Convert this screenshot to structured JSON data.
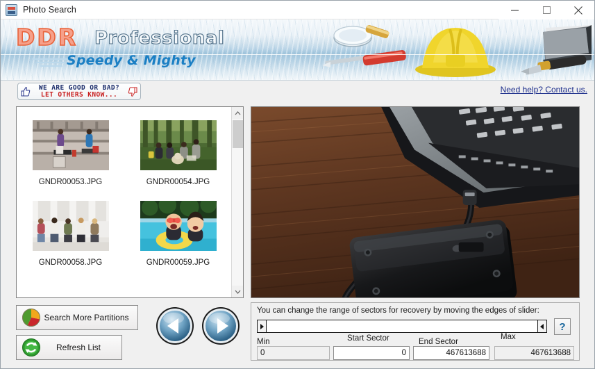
{
  "window": {
    "title": "Photo Search",
    "icon": "app-icon",
    "controls": {
      "minimize": "minimize-icon",
      "maximize": "maximize-icon",
      "close": "close-icon"
    }
  },
  "banner": {
    "brand_primary": "DDR",
    "brand_secondary": "Professional",
    "tagline": "Speedy & Mighty",
    "artwork": [
      "magnifier-icon",
      "screwdriver-icon",
      "hardhat-icon",
      "book-icon",
      "pen-icon"
    ],
    "colors": {
      "brand_orange": "#e8633b",
      "tagline_blue": "#1b7fc4",
      "water_blue": "#9fc4dc"
    }
  },
  "linkrow": {
    "rate_badge_line1": "WE ARE GOOD OR BAD?",
    "rate_badge_line2": "LET OTHERS KNOW...",
    "contact_link": "Need help? Contact us."
  },
  "filelist": {
    "files": [
      {
        "name": "GNDR00053.JPG",
        "scene": "two-women-on-steps"
      },
      {
        "name": "GNDR00054.JPG",
        "scene": "group-picnic-forest"
      },
      {
        "name": "GNDR00058.JPG",
        "scene": "group-of-friends-sitting"
      },
      {
        "name": "GNDR00059.JPG",
        "scene": "kids-in-swimming-pool"
      }
    ],
    "scrollbar": {
      "up_arrow": "chevron-up-icon",
      "down_arrow": "chevron-down-icon"
    }
  },
  "preview": {
    "scene": "external-hard-drive-connected-to-laptop-on-wooden-desk"
  },
  "buttons": {
    "search_more_partitions": "Search More Partitions",
    "refresh_list": "Refresh List",
    "prev": "previous-icon",
    "next": "next-icon"
  },
  "sector_panel": {
    "hint": "You can change the range of sectors for recovery by moving the edges of slider:",
    "help_label": "?",
    "labels": {
      "min": "Min",
      "start_sector": "Start Sector",
      "end_sector": "End Sector",
      "max": "Max"
    },
    "values": {
      "min": "0",
      "start_sector": "0",
      "end_sector": "467613688",
      "max": "467613688"
    }
  }
}
